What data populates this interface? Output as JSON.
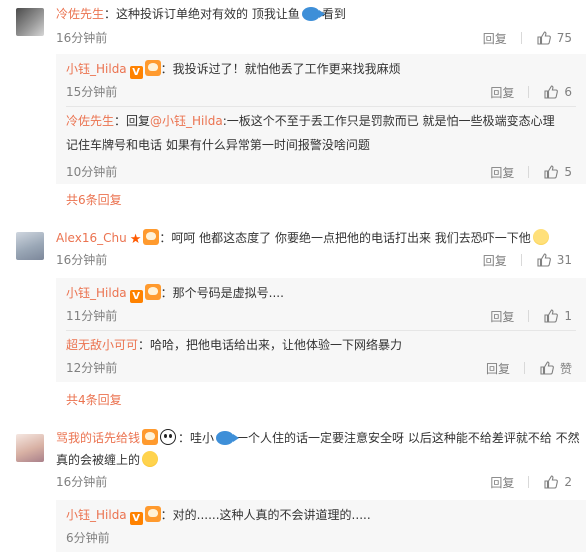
{
  "colors": {
    "accent": "#eb7350",
    "muted": "#808080",
    "reply_bg": "#f7f7f7"
  },
  "comments": [
    {
      "user": "冷佐先生",
      "text_before": "：这种投诉订单绝对有效的 顶我让鱼",
      "text_after": "看到",
      "time": "16分钟前",
      "reply_label": "回复",
      "likes": "75",
      "replies": [
        {
          "user": "小钰_Hilda",
          "text": "：我投诉过了！就怕他丢了工作更来找我麻烦",
          "time": "15分钟前",
          "reply_label": "回复",
          "likes": "6"
        },
        {
          "user": "冷佐先生",
          "text_prefix": "：回复",
          "mention": "@小钰_Hilda",
          "text_line1": ":一板这个不至于丢工作只是罚款而已 就是怕一些极端变态心理",
          "text_line2": "记住车牌号和电话 如果有什么异常第一时间报警没啥问题",
          "time": "10分钟前",
          "reply_label": "回复",
          "likes": "5"
        }
      ],
      "more": "共6条回复"
    },
    {
      "user": "Alex16_Chu",
      "text": "：呵呵 他都这态度了 你要绝一点把他的电话打出来 我们去恐吓一下他",
      "time": "16分钟前",
      "reply_label": "回复",
      "likes": "31",
      "replies": [
        {
          "user": "小钰_Hilda",
          "text": "：那个号码是虚拟号....",
          "time": "11分钟前",
          "reply_label": "回复",
          "likes": "1"
        },
        {
          "user": "超无敌小可可",
          "text": "：哈哈，把他电话给出来，让他体验一下网络暴力",
          "time": "12分钟前",
          "reply_label": "回复",
          "likes": "赞"
        }
      ],
      "more": "共4条回复"
    },
    {
      "user": "骂我的话先给钱",
      "text_before": "：哇小",
      "text_mid": "一个人住的话一定要注意安全呀 以后这种能不给差评就不给 不然",
      "text_line2": "真的会被缠上的",
      "time": "16分钟前",
      "reply_label": "回复",
      "likes": "2",
      "replies": [
        {
          "user": "小钰_Hilda",
          "text": "：对的......这种人真的不会讲道理的.....",
          "time": "6分钟前",
          "reply_label": "回复",
          "likes": ""
        }
      ]
    }
  ],
  "icons": {
    "like": "thumbs-up-icon",
    "verified": "verified-v-icon",
    "fan": "fan-badge-icon",
    "star": "star-icon",
    "fish": "fish-emoji-icon",
    "panda": "panda-emoji-icon",
    "sweat": "sweat-emoji-icon",
    "scared": "scared-emoji-icon"
  }
}
